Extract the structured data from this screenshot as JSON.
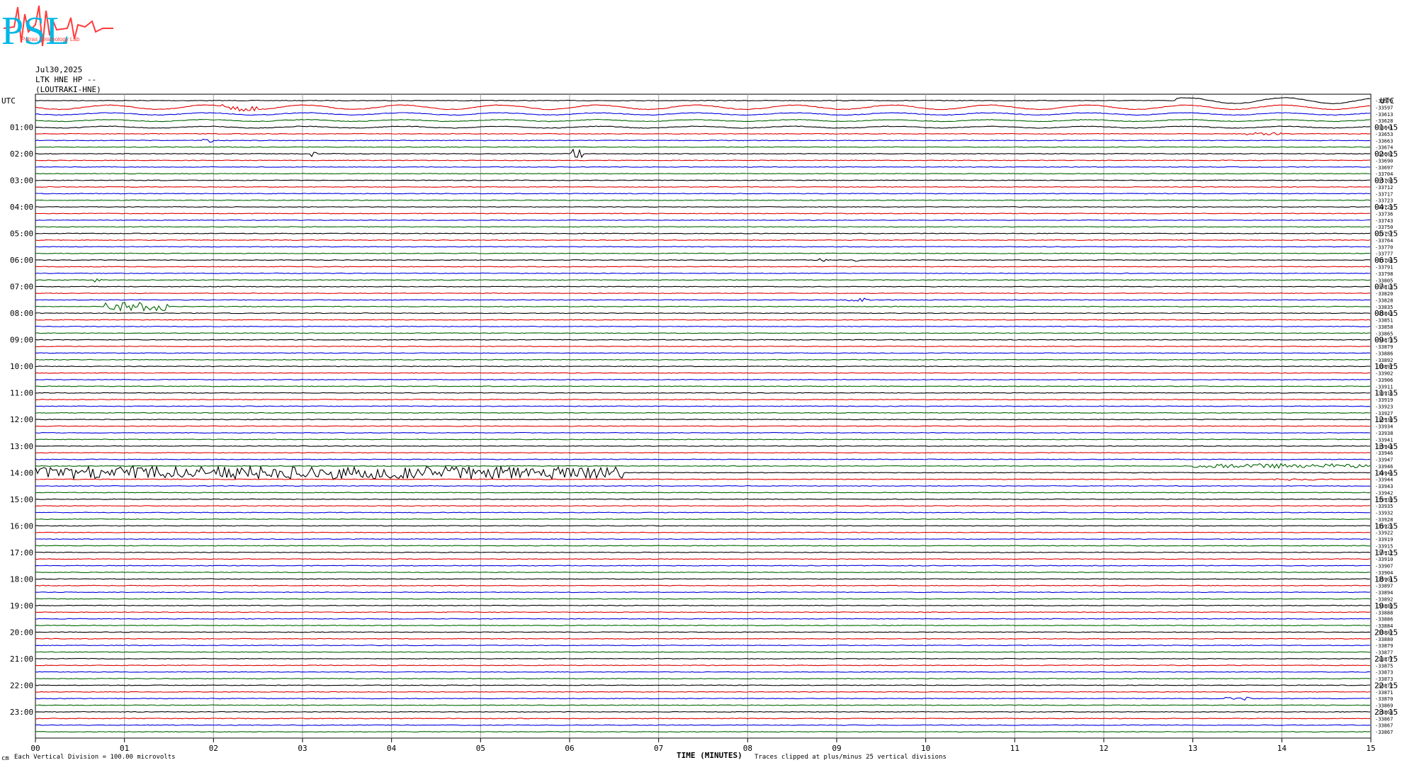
{
  "header": {
    "logo_text": "PSL",
    "logo_subtitle": "Patras Seismology Lab",
    "date": "Jul30,2025",
    "station": "LTK HNE HP --",
    "station_name": "(LOUTRAKI-HNE)"
  },
  "footer": {
    "division_note": "Each Vertical Division =  100.00 microvolts",
    "clip_note": "Traces clipped at plus/minus 25 vertical divisions",
    "corner_mark": "cm"
  },
  "colors": {
    "trace1": "#000000",
    "trace2": "#e00000",
    "trace3": "#0000e0",
    "trace4": "#006400",
    "grid": "#a0a0a0"
  },
  "chart_data": {
    "type": "helicorder",
    "xlabel": "TIME (MINUTES)",
    "x_ticks": [
      "00",
      "01",
      "02",
      "03",
      "04",
      "05",
      "06",
      "07",
      "08",
      "09",
      "10",
      "11",
      "12",
      "13",
      "14",
      "15"
    ],
    "xlim": [
      0,
      15
    ],
    "left_label_top": "UTC",
    "right_label_top": "UTC",
    "left_hours": [
      "01:00",
      "02:00",
      "03:00",
      "04:00",
      "05:00",
      "06:00",
      "07:00",
      "08:00",
      "09:00",
      "10:00",
      "11:00",
      "12:00",
      "13:00",
      "14:00",
      "15:00",
      "16:00",
      "17:00",
      "18:00",
      "19:00",
      "20:00",
      "21:00",
      "22:00",
      "23:00"
    ],
    "right_hours": [
      "01:15",
      "02:15",
      "03:15",
      "04:15",
      "05:15",
      "06:15",
      "07:15",
      "08:15",
      "09:15",
      "10:15",
      "11:15",
      "12:15",
      "13:15",
      "14:15",
      "15:15",
      "16:15",
      "17:15",
      "18:15",
      "19:15",
      "20:15",
      "21:15",
      "22:15",
      "23:15"
    ],
    "trace_color_cycle": [
      "black",
      "red",
      "blue",
      "green"
    ],
    "trace_count": 96,
    "trace_minutes": 15,
    "right_values": [
      "-33579",
      "-33597",
      "-33613",
      "-33628",
      "-33641",
      "-33653",
      "-33663",
      "-33674",
      "-33682",
      "-33690",
      "-33697",
      "-33704",
      "-33708",
      "-33712",
      "-33717",
      "-33723",
      "-33729",
      "-33736",
      "-33743",
      "-33750",
      "-33757",
      "-33764",
      "-33770",
      "-33777",
      "-33784",
      "-33791",
      "-33798",
      "-33805",
      "-33813",
      "-33820",
      "-33828",
      "-33835",
      "-33843",
      "-33851",
      "-33858",
      "-33865",
      "-33873",
      "-33879",
      "-33886",
      "-33892",
      "-33897",
      "-33902",
      "-33906",
      "-33911",
      "-33916",
      "-33919",
      "-33923",
      "-33927",
      "-33930",
      "-33934",
      "-33938",
      "-33941",
      "-33944",
      "-33946",
      "-33947",
      "-33946",
      "-33946",
      "-33944",
      "-33943",
      "-33942",
      "-33939",
      "-33935",
      "-33932",
      "-33928",
      "-33925",
      "-33922",
      "-33919",
      "-33915",
      "-33912",
      "-33910",
      "-33907",
      "-33904",
      "-33901",
      "-33897",
      "-33894",
      "-33892",
      "-33889",
      "-33888",
      "-33886",
      "-33884",
      "-33882",
      "-33880",
      "-33879",
      "-33877",
      "-33877",
      "-33875",
      "-33873",
      "-33873",
      "-33872",
      "-33871",
      "-33870",
      "-33869",
      "-33868",
      "-33867",
      "-33867",
      "-33867",
      "-33867"
    ],
    "events": [
      {
        "trace": 0,
        "start": 12.8,
        "end": 15.0,
        "amp": 4,
        "kind": "swell"
      },
      {
        "trace": 1,
        "start": 0.0,
        "end": 15.0,
        "amp": 3,
        "kind": "swell"
      },
      {
        "trace": 1,
        "start": 2.1,
        "end": 2.5,
        "amp": 4,
        "kind": "burst"
      },
      {
        "trace": 2,
        "start": 0.0,
        "end": 15.0,
        "amp": 1.5,
        "kind": "swell"
      },
      {
        "trace": 3,
        "start": 0.0,
        "end": 15.0,
        "amp": 1.2,
        "kind": "swell"
      },
      {
        "trace": 4,
        "start": 0.0,
        "end": 15.0,
        "amp": 1.2,
        "kind": "swell"
      },
      {
        "trace": 5,
        "start": 13.6,
        "end": 14.0,
        "amp": 2,
        "kind": "burst"
      },
      {
        "trace": 6,
        "start": 1.85,
        "end": 2.0,
        "amp": 4,
        "kind": "burst"
      },
      {
        "trace": 8,
        "start": 3.1,
        "end": 3.2,
        "amp": 5,
        "kind": "burst"
      },
      {
        "trace": 8,
        "start": 6.0,
        "end": 6.15,
        "amp": 7,
        "kind": "burst"
      },
      {
        "trace": 24,
        "start": 8.8,
        "end": 8.9,
        "amp": 2,
        "kind": "burst"
      },
      {
        "trace": 24,
        "start": 9.2,
        "end": 9.25,
        "amp": 2,
        "kind": "burst"
      },
      {
        "trace": 27,
        "start": 0.65,
        "end": 0.75,
        "amp": 4,
        "kind": "burst"
      },
      {
        "trace": 30,
        "start": 9.1,
        "end": 9.4,
        "amp": 2,
        "kind": "burst"
      },
      {
        "trace": 31,
        "start": 0.75,
        "end": 1.5,
        "amp": 6,
        "kind": "burst"
      },
      {
        "trace": 55,
        "start": 13.0,
        "end": 15.0,
        "amp": 3,
        "kind": "burst"
      },
      {
        "trace": 56,
        "start": 0.0,
        "end": 6.6,
        "amp": 9,
        "kind": "burst"
      },
      {
        "trace": 57,
        "start": 13.9,
        "end": 14.4,
        "amp": 1.5,
        "kind": "burst"
      },
      {
        "trace": 90,
        "start": 13.3,
        "end": 13.7,
        "amp": 2,
        "kind": "burst"
      }
    ]
  }
}
